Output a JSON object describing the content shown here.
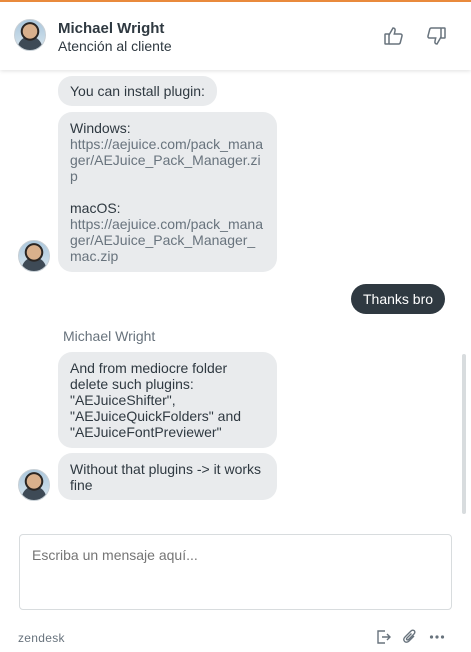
{
  "header": {
    "agent_name": "Michael Wright",
    "agent_role": "Atención al cliente",
    "rate_up_icon": "thumbs-up-icon",
    "rate_down_icon": "thumbs-down-icon"
  },
  "messages": {
    "m1": "You can install plugin:",
    "m2_win_label": "Windows:",
    "m2_win_link": "https://aejuice.com/pack_manager/AEJuice_Pack_Manager.zip",
    "m2_mac_label": "macOS:",
    "m2_mac_link": "https://aejuice.com/pack_manager/AEJuice_Pack_Manager_mac.zip",
    "m3_out": "Thanks bro",
    "sender": "Michael Wright",
    "m4": "And from mediocre folder delete such plugins: \"AEJuiceShifter\", \"AEJuiceQuickFolders\" and \"AEJuiceFontPreviewer\"",
    "m5": "Without that plugins -> it works fine"
  },
  "composer": {
    "placeholder": "Escriba un mensaje aquí..."
  },
  "footer": {
    "brand": "zendesk",
    "icons": [
      "end-chat-icon",
      "attachment-icon",
      "more-icon"
    ]
  },
  "colors": {
    "accent": "#e98a3c",
    "bubble_in": "#e9ebed",
    "bubble_out": "#2f3941",
    "text": "#2f3941",
    "muted": "#68737d"
  }
}
